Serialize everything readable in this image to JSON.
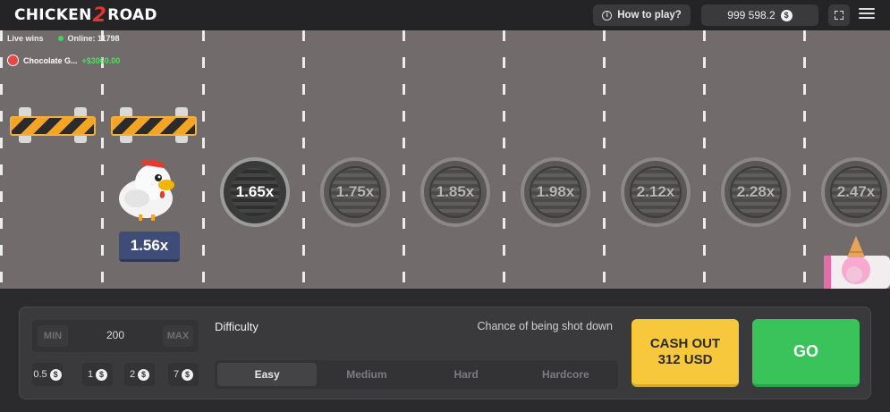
{
  "header": {
    "logo_left": "CHICKEN",
    "logo_mid": "2",
    "logo_right": "ROAD",
    "how_to_play": "How to play?",
    "balance": "999 598.2",
    "currency_symbol": "$"
  },
  "live": {
    "label": "Live wins",
    "online": "Online: 11798",
    "winner_name": "Chocolate G...",
    "winner_amount": "+$3060.00"
  },
  "game": {
    "current_multiplier": "1.56x",
    "multipliers": [
      "1.65x",
      "1.75x",
      "1.85x",
      "1.98x",
      "2.12x",
      "2.28x",
      "2.47x"
    ]
  },
  "controls": {
    "min_label": "MIN",
    "max_label": "MAX",
    "bet_value": "200",
    "quick_bets": [
      "0.5",
      "1",
      "2",
      "7"
    ],
    "difficulty_label": "Difficulty",
    "chance_label": "Chance of being shot down",
    "difficulties": [
      "Easy",
      "Medium",
      "Hard",
      "Hardcore"
    ],
    "active_difficulty": "Easy",
    "cashout_line1": "CASH OUT",
    "cashout_line2": "312 USD",
    "go_label": "GO"
  },
  "colors": {
    "road": "#716c6b",
    "cashout": "#f7c83b",
    "go": "#3ac25b",
    "win": "#49e35f"
  }
}
